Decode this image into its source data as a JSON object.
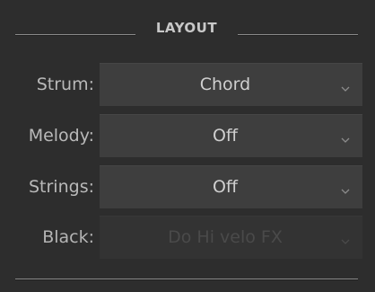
{
  "section": {
    "title": "LAYOUT"
  },
  "rows": [
    {
      "label": "Strum:",
      "value": "Chord",
      "enabled": true
    },
    {
      "label": "Melody:",
      "value": "Off",
      "enabled": true
    },
    {
      "label": "Strings:",
      "value": "Off",
      "enabled": true
    },
    {
      "label": "Black:",
      "value": "Do Hi velo FX",
      "enabled": false
    }
  ],
  "icons": {
    "dropdown": "chevron-down-icon"
  },
  "colors": {
    "background": "#2d2d2d",
    "dropdown_bg": "#3e3e3e",
    "text": "#cfcfcf",
    "label": "#b9b9b9",
    "disabled_text": "#4a4a4a"
  }
}
